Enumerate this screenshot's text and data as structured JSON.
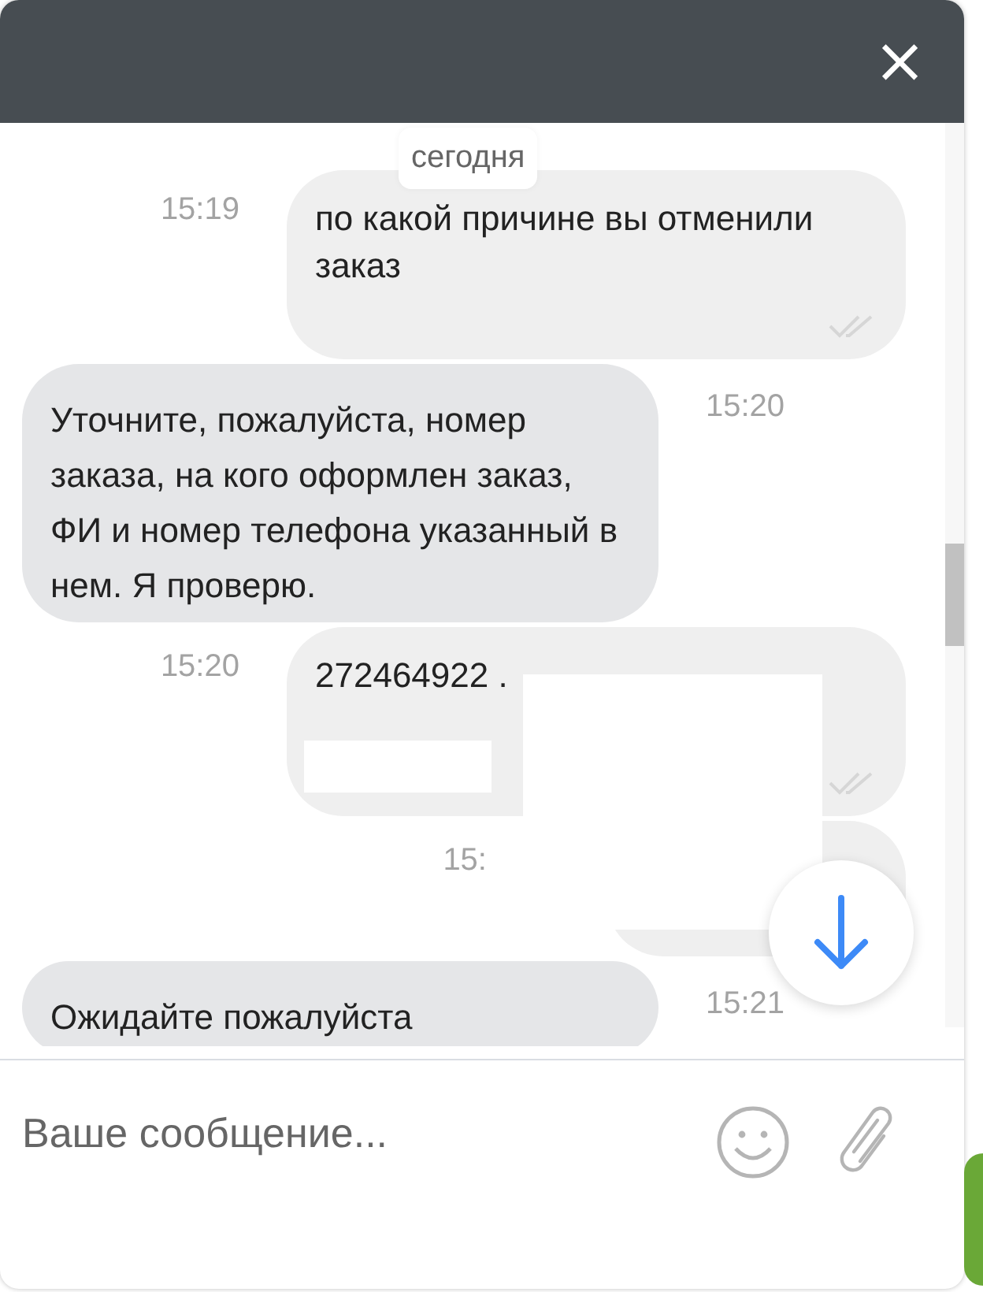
{
  "header": {
    "close": "×"
  },
  "date_label": "сегодня",
  "messages": [
    {
      "kind": "outgoing",
      "time": "15:19",
      "text": "по какой причине вы отменили заказ"
    },
    {
      "kind": "incoming",
      "time": "15:20",
      "text": "Уточните, пожалуйста, номер заказа, на кого оформлен заказ, ФИ и номер телефона указанный в нем. Я проверю."
    },
    {
      "kind": "outgoing",
      "time": "15:20",
      "text": "272464922 ."
    },
    {
      "kind": "outgoing",
      "time": "15:"
    },
    {
      "kind": "incoming",
      "time": "15:21",
      "text": "Ожидайте пожалуйста"
    }
  ],
  "composer": {
    "placeholder": "Ваше сообщение..."
  }
}
